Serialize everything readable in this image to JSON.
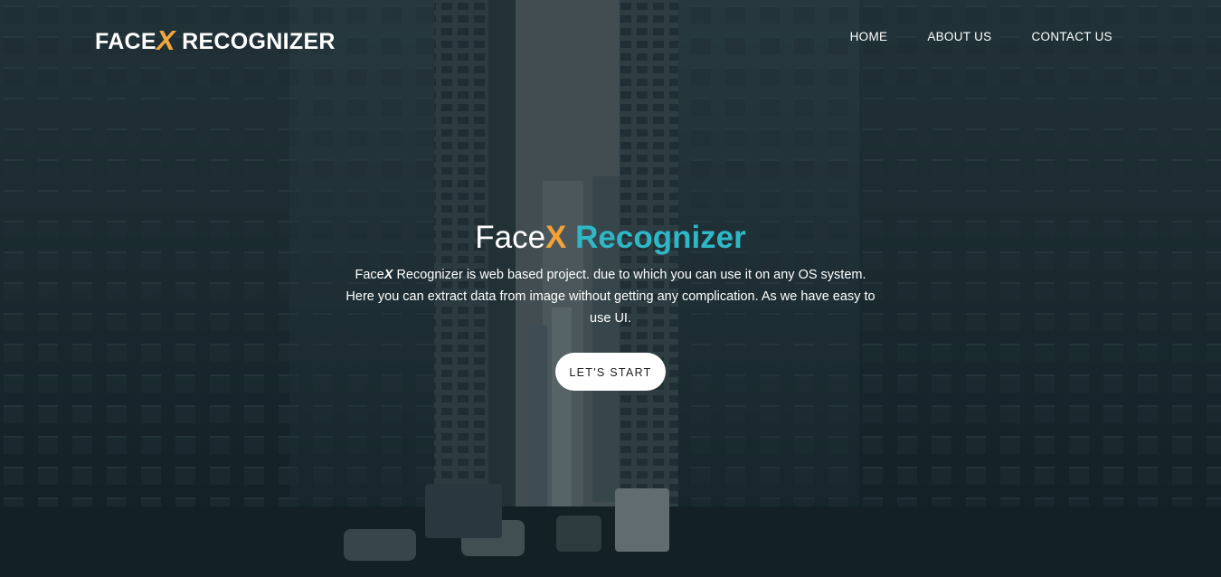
{
  "brand": {
    "prefix": "FACE",
    "x": "X",
    "suffix": " RECOGNIZER"
  },
  "nav": {
    "items": [
      {
        "label": "HOME"
      },
      {
        "label": "ABOUT US"
      },
      {
        "label": "CONTACT US"
      }
    ]
  },
  "hero": {
    "title_prefix": "Face",
    "title_x": "X",
    "title_suffix": " Recognizer",
    "desc_prefix": "Face",
    "desc_x": "X",
    "desc_rest": " Recognizer is web based project. due to which you can use it on any OS system. Here you can extract data from image without getting any complication. As we have easy to use UI.",
    "cta_label": "LET'S START",
    "background_image": "city-street-skyscrapers-photo"
  },
  "colors": {
    "accent_orange": "#f4a236",
    "accent_teal": "#2fb7c6",
    "overlay": "#1c2a30"
  }
}
